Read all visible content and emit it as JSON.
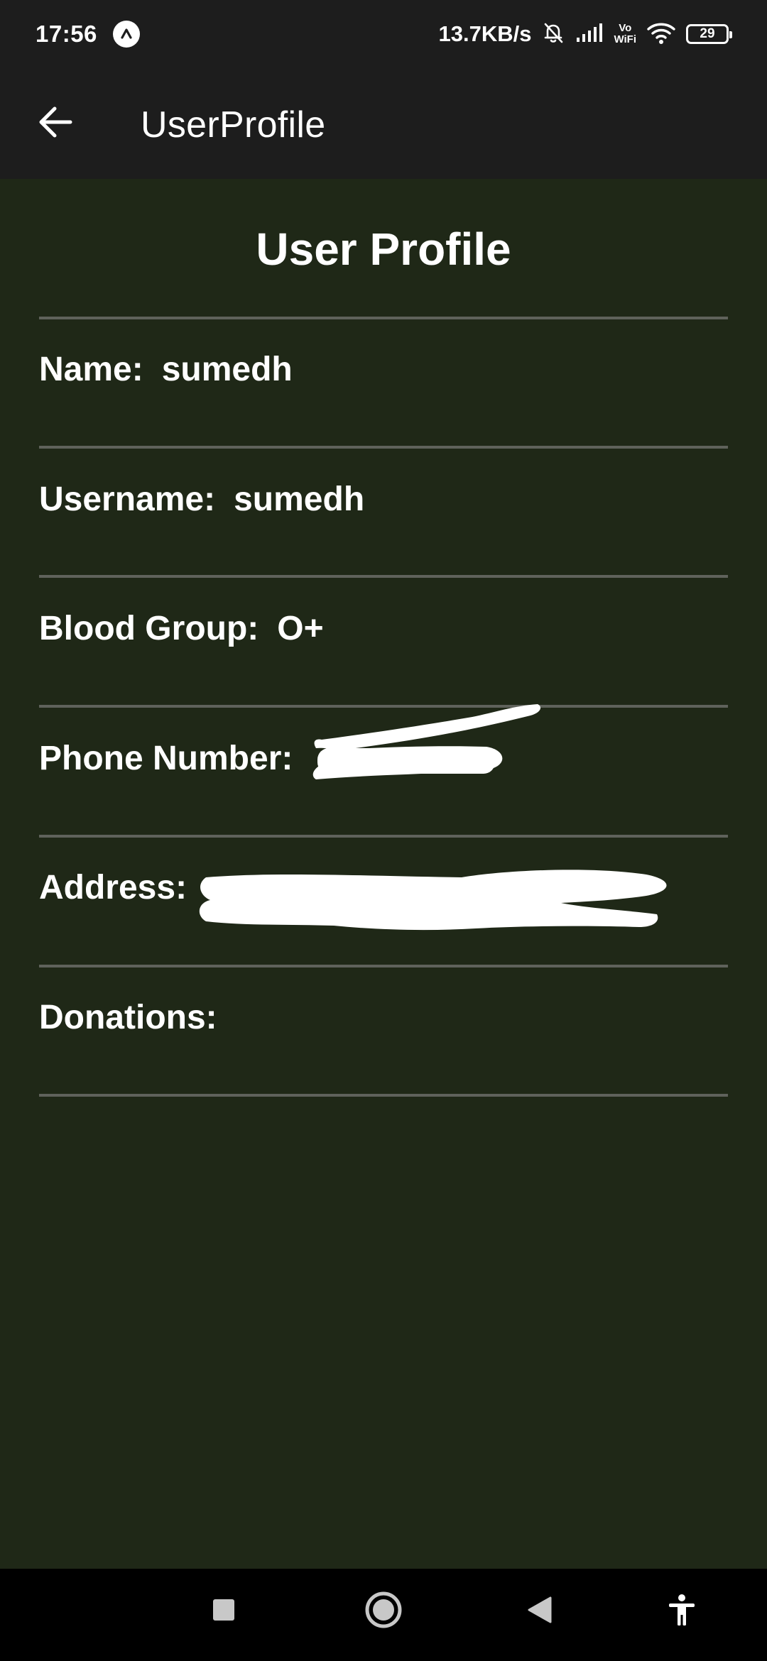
{
  "status_bar": {
    "time": "17:56",
    "net_speed": "13.7KB/s",
    "vowifi_top": "Vo",
    "vowifi_bottom": "WiFi",
    "battery": "29"
  },
  "app_bar": {
    "title": "UserProfile"
  },
  "profile": {
    "heading": "User Profile",
    "fields": [
      {
        "label": "Name:",
        "value": "sumedh"
      },
      {
        "label": "Username:",
        "value": "sumedh"
      },
      {
        "label": "Blood Group:",
        "value": "O+"
      },
      {
        "label": "Phone Number:",
        "value": ""
      },
      {
        "label": "Address:",
        "value": ""
      },
      {
        "label": "Donations:",
        "value": ""
      }
    ]
  },
  "icons": {
    "back": "arrow-left-icon",
    "recents": "square-icon",
    "home": "circle-icon",
    "nav_back": "triangle-left-icon",
    "accessibility": "accessibility-icon"
  }
}
